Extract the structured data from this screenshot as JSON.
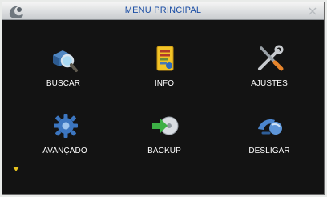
{
  "window": {
    "title": "MENU PRINCIPAL",
    "title_color": "#1b4ea5",
    "background": "#131313"
  },
  "menu": [
    {
      "id": "buscar",
      "label": "BUSCAR",
      "icon": "search-icon"
    },
    {
      "id": "info",
      "label": "INFO",
      "icon": "info-icon"
    },
    {
      "id": "ajustes",
      "label": "AJUSTES",
      "icon": "tools-icon"
    },
    {
      "id": "avancado",
      "label": "AVANÇADO",
      "icon": "gear-icon"
    },
    {
      "id": "backup",
      "label": "BACKUP",
      "icon": "backup-icon"
    },
    {
      "id": "desligar",
      "label": "DESLIGAR",
      "icon": "shutdown-icon"
    }
  ],
  "status": {
    "icon": "hint-icon",
    "color": "#e7c21e"
  }
}
